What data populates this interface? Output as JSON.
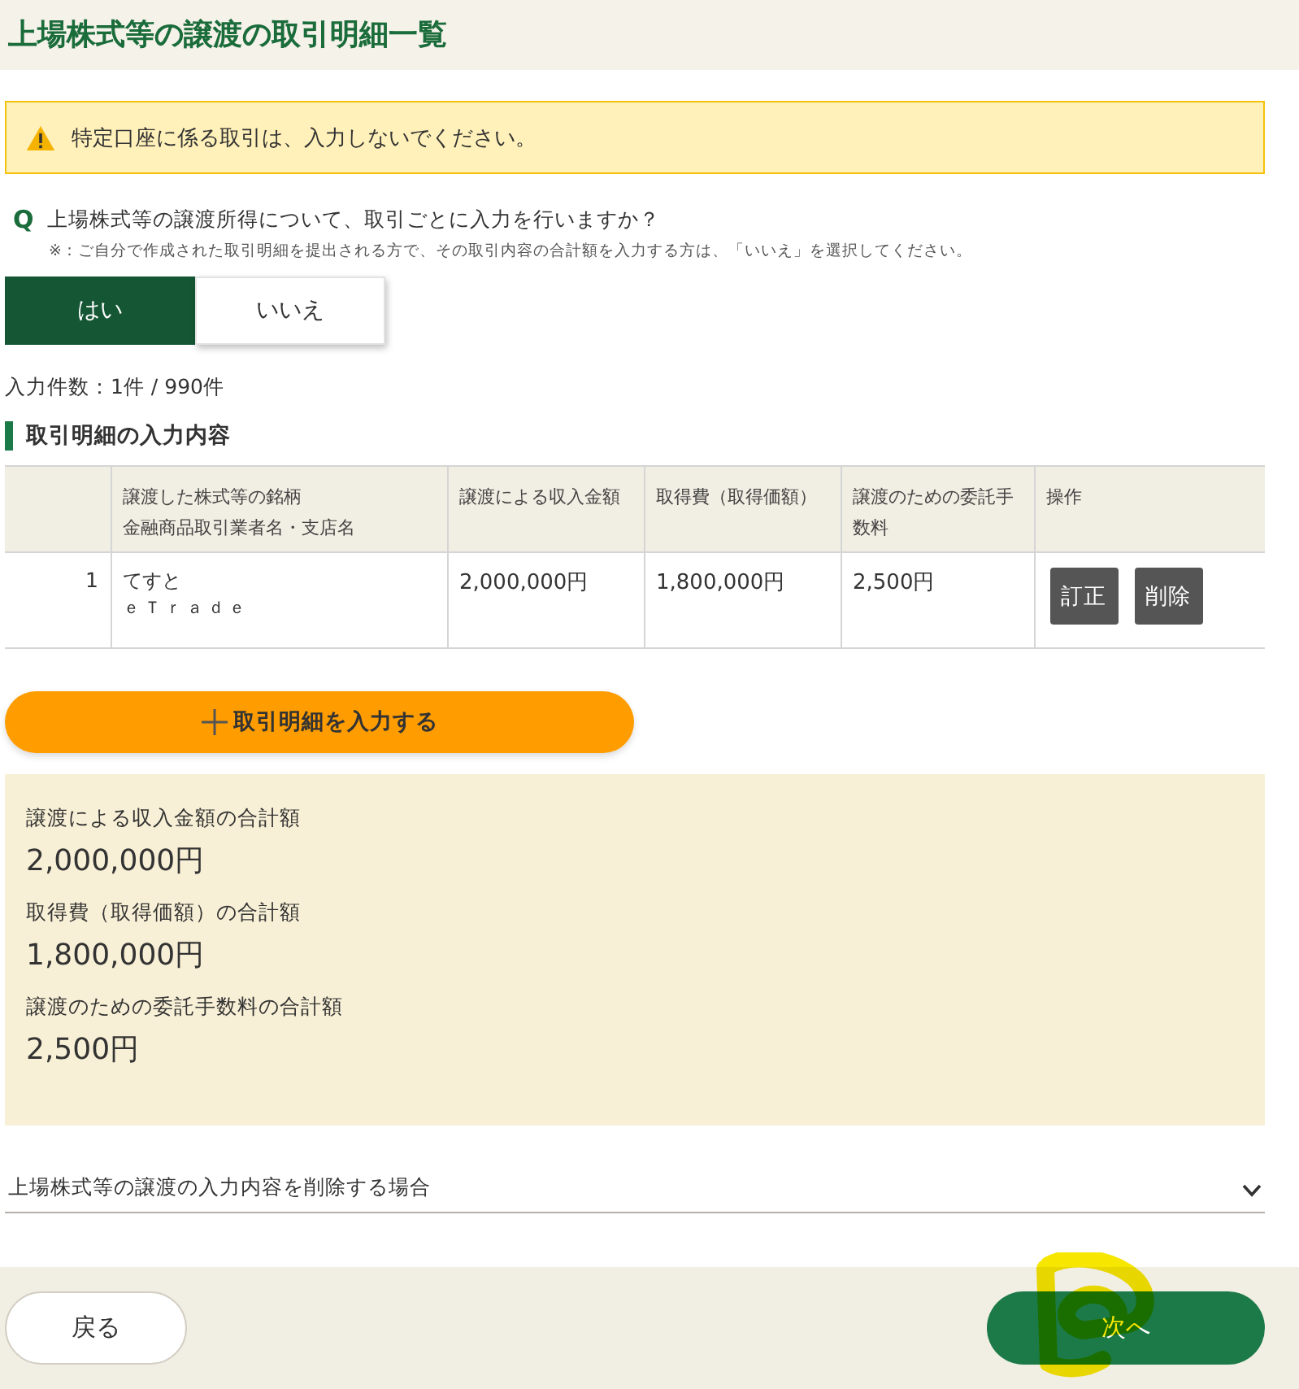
{
  "header": {
    "title": "上場株式等の譲渡の取引明細一覧"
  },
  "alert": {
    "text": "特定口座に係る取引は、入力しないでください。"
  },
  "question": {
    "mark": "Q",
    "text": "上場株式等の譲渡所得について、取引ごとに入力を行いますか？",
    "note": "※：ご自分で作成された取引明細を提出される方で、その取引内容の合計額を入力する方は、「いいえ」を選択してください。"
  },
  "answer_options": [
    {
      "label": "はい",
      "selected": true
    },
    {
      "label": "いいえ",
      "selected": false
    }
  ],
  "entry_count": "入力件数：1件 / 990件",
  "section_title": "取引明細の入力内容",
  "table": {
    "columns": [
      {
        "lines": [
          "譲渡した株式等の銘柄",
          "金融商品取引業者名・支店名"
        ]
      },
      {
        "lines": [
          "譲渡による収入金額"
        ]
      },
      {
        "lines": [
          "取得費（取得価額）"
        ]
      },
      {
        "lines": [
          "譲渡のための委託手",
          "数料"
        ]
      },
      {
        "lines": [
          "操作"
        ]
      }
    ],
    "rows": [
      {
        "number": "1",
        "security": "てすと",
        "broker": "ｅＴｒａｄｅ",
        "proceeds": "2,000,000円",
        "cost": "1,800,000円",
        "commission": "2,500円",
        "actions": [
          "訂正",
          "削除"
        ]
      }
    ]
  },
  "add_button": {
    "label": "取引明細を入力する"
  },
  "totals": [
    {
      "label": "譲渡による収入金額の合計額",
      "value": "2,000,000円"
    },
    {
      "label": "取得費（取得価額）の合計額",
      "value": "1,800,000円"
    },
    {
      "label": "譲渡のための委託手数料の合計額",
      "value": "2,500円"
    }
  ],
  "accordion": {
    "label": "上場株式等の譲渡の入力内容を削除する場合",
    "expanded": false
  },
  "footer": {
    "back_button": "戻る",
    "next_button": "次へ"
  }
}
